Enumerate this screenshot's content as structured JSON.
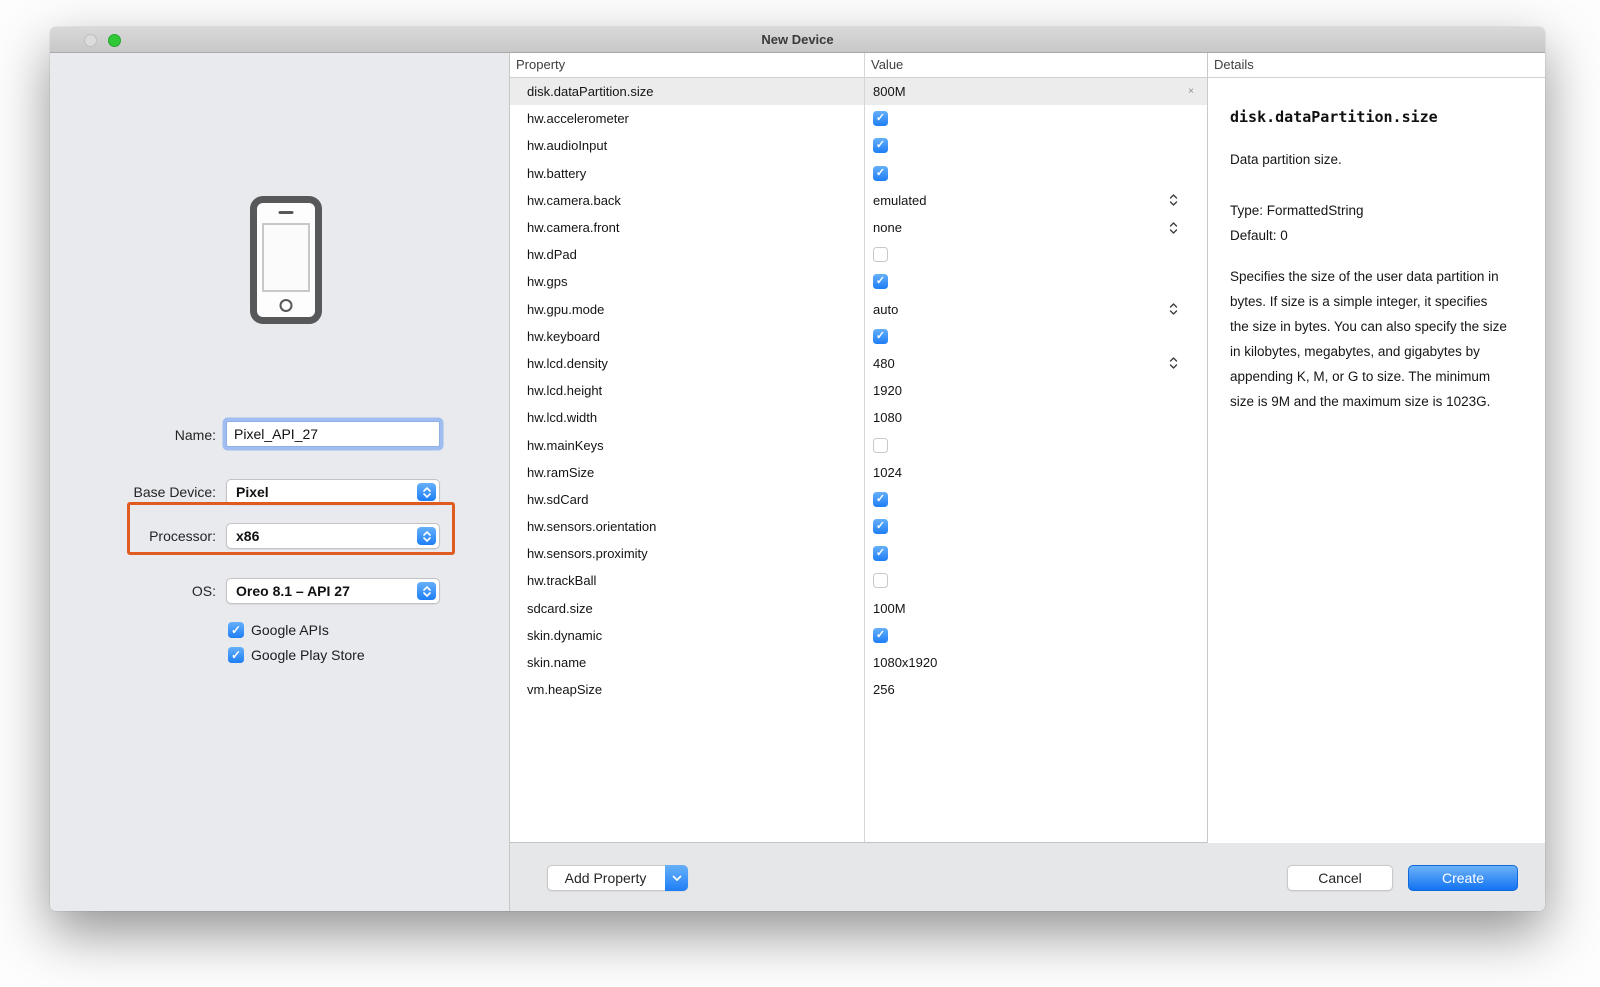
{
  "window": {
    "title": "New Device"
  },
  "left_panel": {
    "fields": [
      {
        "label": "Name:",
        "value": "Pixel_API_27",
        "type": "text"
      },
      {
        "label": "Base Device:",
        "value": "Pixel",
        "type": "select"
      },
      {
        "label": "Processor:",
        "value": "x86",
        "type": "select",
        "highlighted": true
      },
      {
        "label": "OS:",
        "value": "Oreo 8.1 – API 27",
        "type": "select"
      }
    ],
    "checkboxes": [
      {
        "label": "Google APIs",
        "checked": true
      },
      {
        "label": "Google Play Store",
        "checked": true
      }
    ]
  },
  "table": {
    "columns": [
      "Property",
      "Value"
    ],
    "rows": [
      {
        "property": "disk.dataPartition.size",
        "type": "text",
        "value": "800M",
        "selected": true,
        "clearable": true
      },
      {
        "property": "hw.accelerometer",
        "type": "checkbox",
        "checked": true
      },
      {
        "property": "hw.audioInput",
        "type": "checkbox",
        "checked": true
      },
      {
        "property": "hw.battery",
        "type": "checkbox",
        "checked": true
      },
      {
        "property": "hw.camera.back",
        "type": "select",
        "value": "emulated"
      },
      {
        "property": "hw.camera.front",
        "type": "select",
        "value": "none"
      },
      {
        "property": "hw.dPad",
        "type": "checkbox",
        "checked": false
      },
      {
        "property": "hw.gps",
        "type": "checkbox",
        "checked": true
      },
      {
        "property": "hw.gpu.mode",
        "type": "select",
        "value": "auto"
      },
      {
        "property": "hw.keyboard",
        "type": "checkbox",
        "checked": true
      },
      {
        "property": "hw.lcd.density",
        "type": "select",
        "value": "480"
      },
      {
        "property": "hw.lcd.height",
        "type": "text",
        "value": "1920"
      },
      {
        "property": "hw.lcd.width",
        "type": "text",
        "value": "1080"
      },
      {
        "property": "hw.mainKeys",
        "type": "checkbox",
        "checked": false
      },
      {
        "property": "hw.ramSize",
        "type": "text",
        "value": "1024"
      },
      {
        "property": "hw.sdCard",
        "type": "checkbox",
        "checked": true
      },
      {
        "property": "hw.sensors.orientation",
        "type": "checkbox",
        "checked": true
      },
      {
        "property": "hw.sensors.proximity",
        "type": "checkbox",
        "checked": true
      },
      {
        "property": "hw.trackBall",
        "type": "checkbox",
        "checked": false
      },
      {
        "property": "sdcard.size",
        "type": "text",
        "value": "100M"
      },
      {
        "property": "skin.dynamic",
        "type": "checkbox",
        "checked": true
      },
      {
        "property": "skin.name",
        "type": "text",
        "value": "1080x1920"
      },
      {
        "property": "vm.heapSize",
        "type": "text",
        "value": "256"
      }
    ]
  },
  "details": {
    "header": "Details",
    "title": "disk.dataPartition.size",
    "summary": "Data partition size.",
    "type_line": "Type: FormattedString",
    "default_line": "Default: 0",
    "description": "Specifies the size of the user data partition in bytes. If size is a simple integer, it specifies the size in bytes. You can also specify the size in kilobytes, megabytes, and gigabytes by appending K, M, or G to size. The minimum size is 9M and the maximum size is 1023G."
  },
  "footer": {
    "add_property_label": "Add Property",
    "cancel_label": "Cancel",
    "create_label": "Create"
  },
  "colors": {
    "accent_blue": "#1e7ef6",
    "accent_blue_light": "#66b0fa",
    "highlight_orange": "#e05b20",
    "traffic_green": "#31c838"
  }
}
